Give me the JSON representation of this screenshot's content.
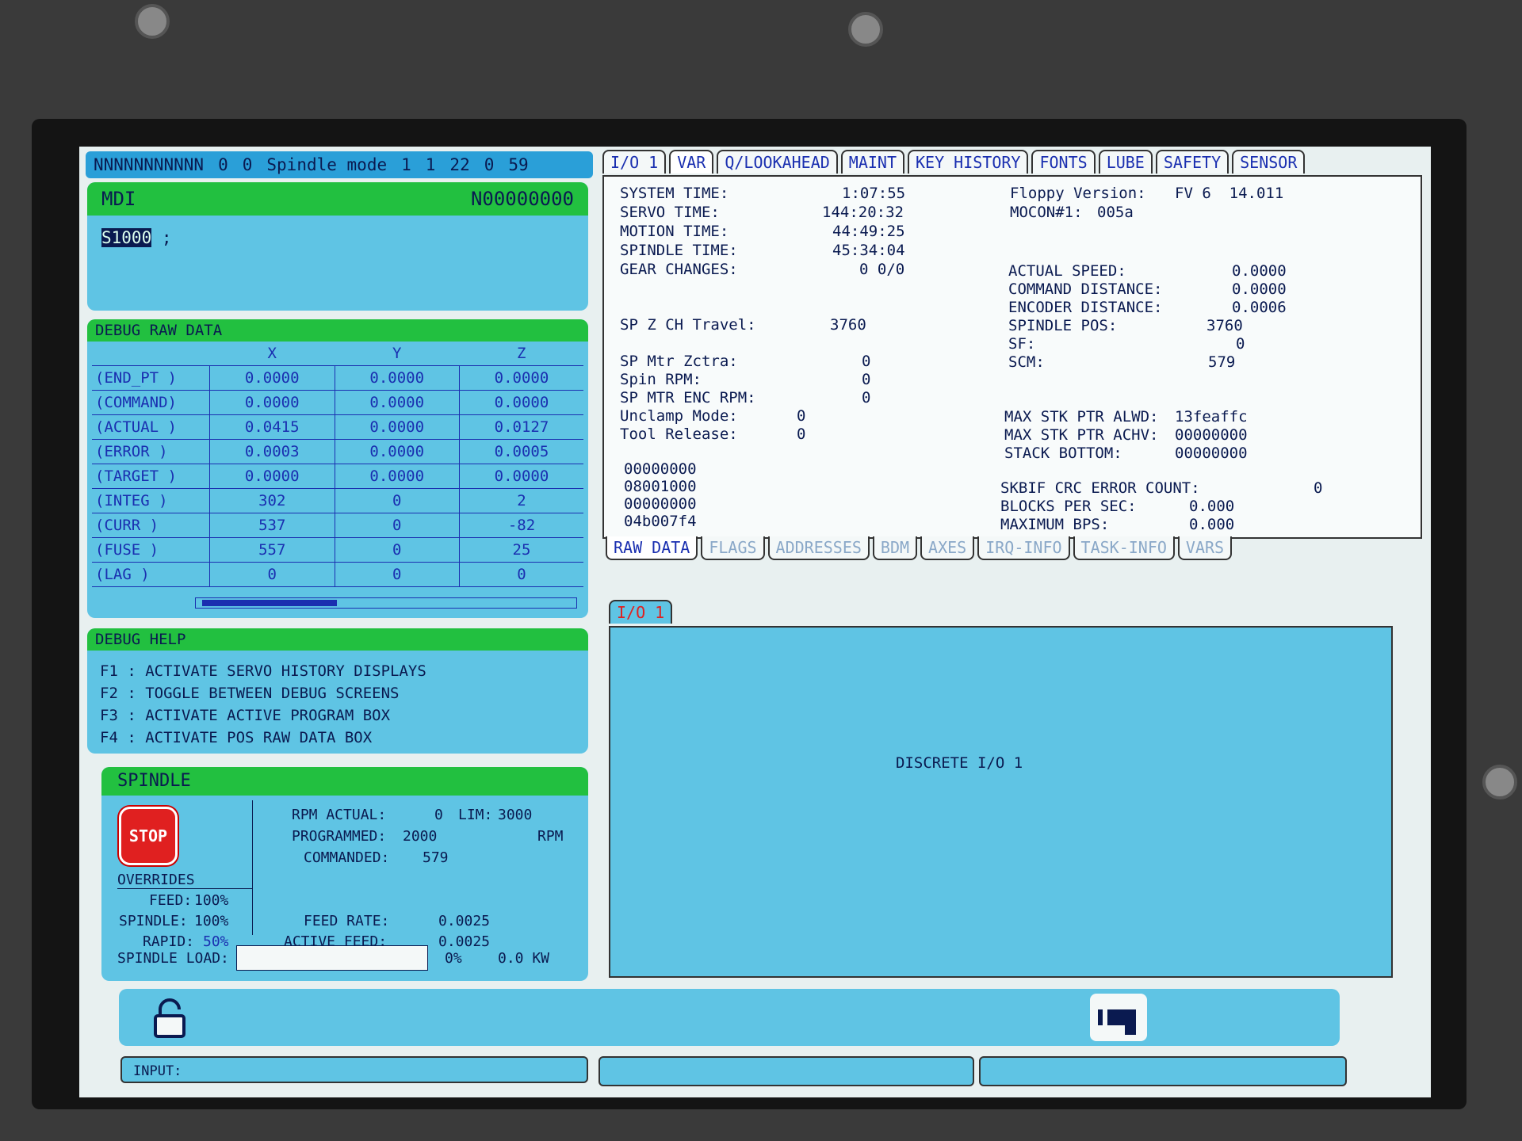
{
  "status_bar": {
    "ident": "NNNNNNNNNNN",
    "v1": "0",
    "v2": "0",
    "mode": "Spindle mode",
    "n1": "1",
    "n2": "1",
    "n3": "22",
    "n4": "0",
    "n5": "59"
  },
  "mdi": {
    "title": "MDI",
    "program": "N00000000",
    "command": "S1000",
    "terminator": ";"
  },
  "debug": {
    "title": "DEBUG RAW DATA",
    "columns": [
      "X",
      "Y",
      "Z"
    ],
    "rows": [
      {
        "label": "(END_PT  )",
        "x": "0.0000",
        "y": "0.0000",
        "z": "0.0000"
      },
      {
        "label": "(COMMAND)",
        "x": "0.0000",
        "y": "0.0000",
        "z": "0.0000"
      },
      {
        "label": "(ACTUAL  )",
        "x": "0.0415",
        "y": "0.0000",
        "z": "0.0127"
      },
      {
        "label": "(ERROR   )",
        "x": "0.0003",
        "y": "0.0000",
        "z": "0.0005"
      },
      {
        "label": "(TARGET  )",
        "x": "0.0000",
        "y": "0.0000",
        "z": "0.0000"
      },
      {
        "label": "(INTEG   )",
        "x": "302",
        "y": "0",
        "z": "2"
      },
      {
        "label": "(CURR    )",
        "x": "537",
        "y": "0",
        "z": "-82"
      },
      {
        "label": "(FUSE    )",
        "x": "557",
        "y": "0",
        "z": "25"
      },
      {
        "label": "(LAG     )",
        "x": "0",
        "y": "0",
        "z": "0"
      }
    ]
  },
  "help": {
    "title": "DEBUG HELP",
    "lines": [
      "F1 : ACTIVATE SERVO HISTORY DISPLAYS",
      "F2 : TOGGLE BETWEEN DEBUG SCREENS",
      "F3 : ACTIVATE ACTIVE PROGRAM BOX",
      "F4 : ACTIVATE POS RAW DATA BOX"
    ]
  },
  "spindle": {
    "title": "SPINDLE",
    "stop": "STOP",
    "rpm_actual_label": "RPM ACTUAL:",
    "rpm_actual": "0",
    "lim_label": "LIM:",
    "lim": "3000",
    "programmed_label": "PROGRAMMED:",
    "programmed": "2000",
    "rpm_unit": "RPM",
    "commanded_label": "COMMANDED:",
    "commanded": "579",
    "overrides": "OVERRIDES",
    "feed_label": "FEED:",
    "feed": "100%",
    "spindle_label": "SPINDLE:",
    "spindle_ov": "100%",
    "rapid_label": "RAPID:",
    "rapid": "50%",
    "feed_rate_label": "FEED RATE:",
    "feed_rate": "0.0025",
    "active_feed_label": "ACTIVE FEED:",
    "active_feed": "0.0025",
    "load_label": "SPINDLE LOAD:",
    "load_pct": "0%",
    "load_kw": "0.0 KW",
    "load_fraction": 0
  },
  "tabs": [
    "I/O 1",
    "VAR",
    "Q/LOOKAHEAD",
    "MAINT",
    "KEY HISTORY",
    "FONTS",
    "LUBE",
    "SAFETY",
    "SENSOR"
  ],
  "var": {
    "system_time_label": "SYSTEM TIME:",
    "system_time": "1:07:55",
    "servo_time_label": "SERVO TIME:",
    "servo_time": "144:20:32",
    "motion_time_label": "MOTION TIME:",
    "motion_time": "44:49:25",
    "spindle_time_label": "SPINDLE TIME:",
    "spindle_time": "45:34:04",
    "gear_changes_label": "GEAR CHANGES:",
    "gear_changes": "0 0/0",
    "sp_z_ch_label": "SP Z CH Travel:",
    "sp_z_ch": "3760",
    "sp_mtr_label": "SP Mtr Zctra:",
    "sp_mtr": "0",
    "spin_rpm_label": "Spin RPM:",
    "spin_rpm": "0",
    "sp_enc_label": "SP MTR ENC RPM:",
    "sp_enc": "0",
    "unclamp_label": "Unclamp Mode:",
    "unclamp": "0",
    "tool_release_label": "Tool Release:",
    "tool_release": "0",
    "hex": [
      "00000000",
      "08001000",
      "00000000",
      "04b007f4"
    ],
    "floppy_label": "Floppy Version:",
    "floppy": "FV 6  14.011",
    "mocon_label": "MOCON#1:",
    "mocon": "005a",
    "actual_speed_label": "ACTUAL SPEED:",
    "actual_speed": "0.0000",
    "cmd_dist_label": "COMMAND DISTANCE:",
    "cmd_dist": "0.0000",
    "enc_dist_label": "ENCODER DISTANCE:",
    "enc_dist": "0.0006",
    "spindle_pos_label": "SPINDLE POS:",
    "spindle_pos": "3760",
    "sf_label": "SF:",
    "sf": "0",
    "scm_label": "SCM:",
    "scm": "579",
    "max_alwd_label": "MAX STK PTR ALWD:",
    "max_alwd": "13feaffc",
    "max_achv_label": "MAX STK PTR ACHV:",
    "max_achv": "00000000",
    "stack_bottom_label": "STACK BOTTOM:",
    "stack_bottom": "00000000",
    "crc_label": "SKBIF CRC ERROR COUNT:",
    "crc": "0",
    "bps_label": "BLOCKS PER SEC:",
    "bps": "0.000",
    "max_bps_label": "MAXIMUM BPS:",
    "max_bps": "0.000"
  },
  "subtabs": [
    "RAW DATA",
    "FLAGS",
    "ADDRESSES",
    "BDM",
    "AXES",
    "IRQ-INFO",
    "TASK-INFO",
    "VARS"
  ],
  "lower": {
    "tab": "I/O 1",
    "content": "DISCRETE I/O 1"
  },
  "input": {
    "label": "INPUT:"
  }
}
